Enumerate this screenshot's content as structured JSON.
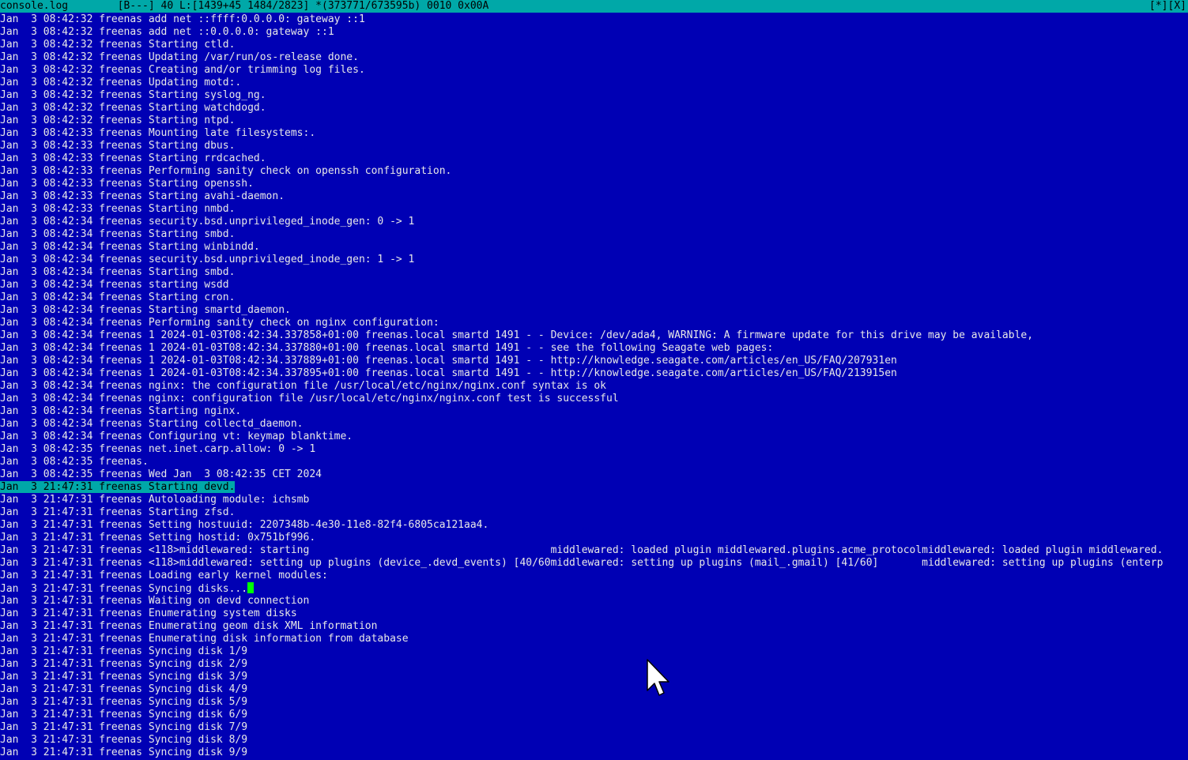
{
  "status_bar": {
    "filename": "console.log",
    "info": "[B---] 40 L:[1439+45 1484/2823] *(373771/673595b) 0010 0x00A",
    "right": "[*][X]"
  },
  "log": {
    "lines": [
      "Jan  3 08:42:32 freenas add net ::ffff:0.0.0.0: gateway ::1",
      "Jan  3 08:42:32 freenas add net ::0.0.0.0: gateway ::1",
      "Jan  3 08:42:32 freenas Starting ctld.",
      "Jan  3 08:42:32 freenas Updating /var/run/os-release done.",
      "Jan  3 08:42:32 freenas Creating and/or trimming log files.",
      "Jan  3 08:42:32 freenas Updating motd:.",
      "Jan  3 08:42:32 freenas Starting syslog_ng.",
      "Jan  3 08:42:32 freenas Starting watchdogd.",
      "Jan  3 08:42:32 freenas Starting ntpd.",
      "Jan  3 08:42:33 freenas Mounting late filesystems:.",
      "Jan  3 08:42:33 freenas Starting dbus.",
      "Jan  3 08:42:33 freenas Starting rrdcached.",
      "Jan  3 08:42:33 freenas Performing sanity check on openssh configuration.",
      "Jan  3 08:42:33 freenas Starting openssh.",
      "Jan  3 08:42:33 freenas Starting avahi-daemon.",
      "Jan  3 08:42:33 freenas Starting nmbd.",
      "Jan  3 08:42:34 freenas security.bsd.unprivileged_inode_gen: 0 -> 1",
      "Jan  3 08:42:34 freenas Starting smbd.",
      "Jan  3 08:42:34 freenas Starting winbindd.",
      "Jan  3 08:42:34 freenas security.bsd.unprivileged_inode_gen: 1 -> 1",
      "Jan  3 08:42:34 freenas Starting smbd.",
      "Jan  3 08:42:34 freenas starting wsdd",
      "Jan  3 08:42:34 freenas Starting cron.",
      "Jan  3 08:42:34 freenas Starting smartd_daemon.",
      "Jan  3 08:42:34 freenas Performing sanity check on nginx configuration:",
      "Jan  3 08:42:34 freenas 1 2024-01-03T08:42:34.337858+01:00 freenas.local smartd 1491 - - Device: /dev/ada4, WARNING: A firmware update for this drive may be available,",
      "Jan  3 08:42:34 freenas 1 2024-01-03T08:42:34.337880+01:00 freenas.local smartd 1491 - - see the following Seagate web pages:",
      "Jan  3 08:42:34 freenas 1 2024-01-03T08:42:34.337889+01:00 freenas.local smartd 1491 - - http://knowledge.seagate.com/articles/en_US/FAQ/207931en",
      "Jan  3 08:42:34 freenas 1 2024-01-03T08:42:34.337895+01:00 freenas.local smartd 1491 - - http://knowledge.seagate.com/articles/en_US/FAQ/213915en",
      "Jan  3 08:42:34 freenas nginx: the configuration file /usr/local/etc/nginx/nginx.conf syntax is ok",
      "Jan  3 08:42:34 freenas nginx: configuration file /usr/local/etc/nginx/nginx.conf test is successful",
      "Jan  3 08:42:34 freenas Starting nginx.",
      "Jan  3 08:42:34 freenas Starting collectd_daemon.",
      "Jan  3 08:42:34 freenas Configuring vt: keymap blanktime.",
      "Jan  3 08:42:35 freenas net.inet.carp.allow: 0 -> 1",
      "Jan  3 08:42:35 freenas.",
      "Jan  3 08:42:35 freenas Wed Jan  3 08:42:35 CET 2024",
      "Jan  3 21:47:31 freenas Starting devd.",
      "Jan  3 21:47:31 freenas Autoloading module: ichsmb",
      "Jan  3 21:47:31 freenas Starting zfsd.",
      "Jan  3 21:47:31 freenas Setting hostuuid: 2207348b-4e30-11e8-82f4-6805ca121aa4.",
      "Jan  3 21:47:31 freenas Setting hostid: 0x751bf996.",
      "Jan  3 21:47:31 freenas <118>middlewared: starting                                       middlewared: loaded plugin middlewared.plugins.acme_protocolmiddlewared: loaded plugin middlewared.",
      "Jan  3 21:47:31 freenas <118>middlewared: setting up plugins (device_.devd_events) [40/60middlewared: setting up plugins (mail_.gmail) [41/60]       middlewared: setting up plugins (enterp",
      "Jan  3 21:47:31 freenas Loading early kernel modules:",
      "Jan  3 21:47:31 freenas Syncing disks...",
      "Jan  3 21:47:31 freenas Waiting on devd connection",
      "Jan  3 21:47:31 freenas Enumerating system disks",
      "Jan  3 21:47:31 freenas Enumerating geom disk XML information",
      "Jan  3 21:47:31 freenas Enumerating disk information from database",
      "Jan  3 21:47:31 freenas Syncing disk 1/9",
      "Jan  3 21:47:31 freenas Syncing disk 2/9",
      "Jan  3 21:47:31 freenas Syncing disk 3/9",
      "Jan  3 21:47:31 freenas Syncing disk 4/9",
      "Jan  3 21:47:31 freenas Syncing disk 5/9",
      "Jan  3 21:47:31 freenas Syncing disk 6/9",
      "Jan  3 21:47:31 freenas Syncing disk 7/9",
      "Jan  3 21:47:31 freenas Syncing disk 8/9",
      "Jan  3 21:47:31 freenas Syncing disk 9/9"
    ],
    "selected_index": 37,
    "cursor_index": 45
  },
  "colors": {
    "background": "#0000b4",
    "text": "#e8e8e8",
    "highlight": "#00a8a8",
    "cursor": "#00ff00"
  },
  "icons": {
    "mouse_pointer": "arrow-cursor-icon"
  }
}
